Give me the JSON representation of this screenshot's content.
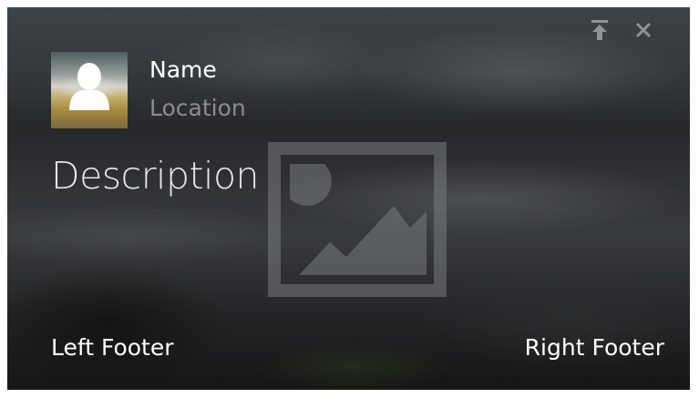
{
  "card": {
    "name": "Name",
    "location": "Location",
    "description": "Description",
    "left_footer": "Left Footer",
    "right_footer": "Right Footer"
  },
  "icons": {
    "pin": "pin-to-top-icon",
    "close": "close-icon",
    "avatar": "person-silhouette-icon",
    "placeholder": "image-placeholder-icon"
  },
  "colors": {
    "primary_text": "#ffffff",
    "secondary_text": "#8a8c8d",
    "icon": "#8e9396"
  }
}
